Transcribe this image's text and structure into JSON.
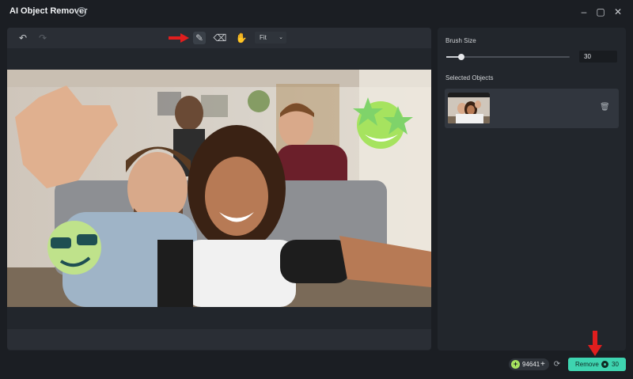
{
  "window": {
    "title": "AI Object Remover",
    "help_icon": "?",
    "minimize": "–",
    "maximize": "▢",
    "close": "✕"
  },
  "toolbar": {
    "undo": "↶",
    "redo": "↷",
    "brush": "✎",
    "eraser": "⌫",
    "hand": "✋",
    "zoom_value": "Fit",
    "zoom_chevron": "⌄"
  },
  "side": {
    "brush_size_label": "Brush Size",
    "brush_size_value": "30",
    "brush_size_fraction": 0.12,
    "selected_objects_label": "Selected Objects",
    "trash_glyph": "🗑"
  },
  "footer": {
    "credits_value": "94641",
    "credits_plus": "+",
    "refresh_glyph": "⟳",
    "remove_label": "Remove",
    "remove_cost": "30"
  },
  "colors": {
    "accent": "#3ed4b0",
    "credit_coin": "#a6e35f",
    "annotation_arrow": "#e01e1e"
  }
}
